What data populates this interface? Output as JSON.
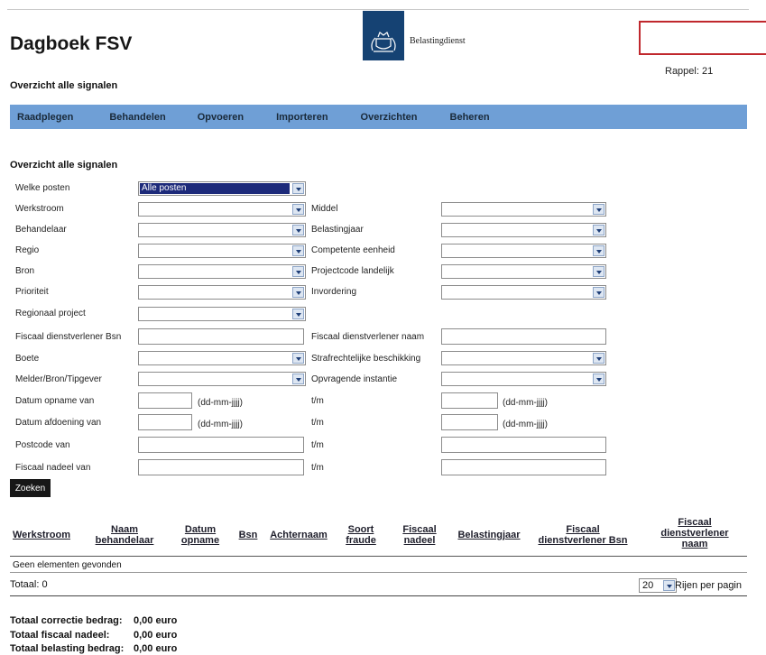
{
  "header": {
    "app_title": "Dagboek FSV",
    "logo_text": "Belastingdienst",
    "rappel_label": "Rappel:",
    "rappel_value": "21",
    "subtitle": "Overzicht alle signalen"
  },
  "nav": [
    "Raadplegen",
    "Behandelen",
    "Opvoeren",
    "Importeren",
    "Overzichten",
    "Beheren"
  ],
  "form": {
    "title": "Overzicht alle signalen",
    "welke_posten": {
      "label": "Welke posten",
      "value": "Alle posten"
    },
    "left_selects": [
      "Werkstroom",
      "Behandelaar",
      "Regio",
      "Bron",
      "Prioriteit",
      "Regionaal project"
    ],
    "right_selects": [
      "Middel",
      "Belastingjaar",
      "Competente eenheid",
      "Projectcode landelijk",
      "Invordering"
    ],
    "fiscaal_bsn_label": "Fiscaal dienstverlener Bsn",
    "fiscaal_naam_label": "Fiscaal dienstverlener naam",
    "boete_label": "Boete",
    "strafrecht_label": "Strafrechtelijke beschikking",
    "melder_label": "Melder/Bron/Tipgever",
    "opvragende_label": "Opvragende instantie",
    "datum_opname_label": "Datum opname van",
    "datum_afdoening_label": "Datum afdoening van",
    "postcode_label": "Postcode van",
    "fiscaal_nadeel_label": "Fiscaal nadeel van",
    "tm_label": "t/m",
    "date_hint": "(dd-mm-jjjj)",
    "search_button": "Zoeken"
  },
  "table": {
    "headers": [
      [
        "Werkstroom"
      ],
      [
        "Naam",
        "behandelaar"
      ],
      [
        "Datum",
        "opname"
      ],
      [
        "Bsn"
      ],
      [
        "Achternaam"
      ],
      [
        "Soort",
        "fraude"
      ],
      [
        "Fiscaal",
        "nadeel"
      ],
      [
        "Belastingjaar"
      ],
      [
        "Fiscaal",
        "dienstverlener Bsn"
      ],
      [
        "Fiscaal",
        "dienstverlener",
        "naam"
      ]
    ],
    "empty_text": "Geen elementen gevonden",
    "totaal": "Totaal: 0",
    "rows_per_page_value": "20",
    "rows_per_page_label": "Rijen per pagin"
  },
  "summary": [
    {
      "label": "Totaal correctie bedrag:",
      "value": "0,00 euro"
    },
    {
      "label": "Totaal fiscaal nadeel:",
      "value": "0,00 euro"
    },
    {
      "label": "Totaal belasting bedrag:",
      "value": "0,00 euro"
    }
  ]
}
